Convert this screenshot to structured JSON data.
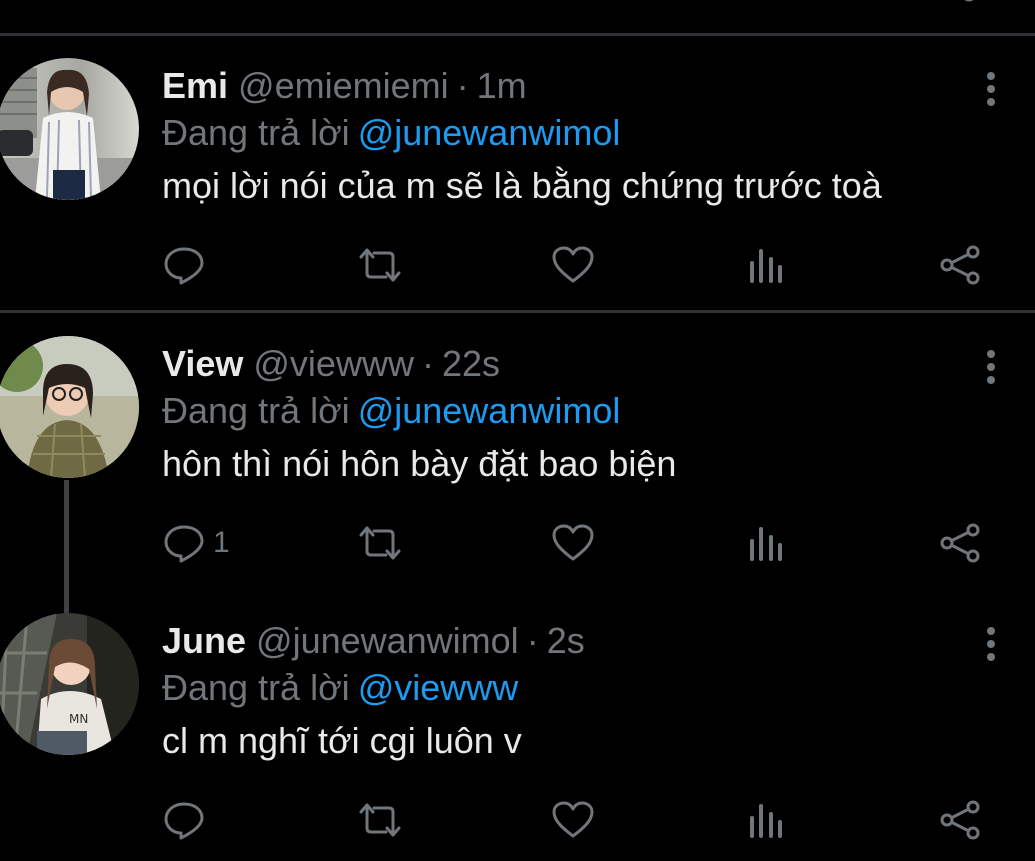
{
  "reply_prefix": "Đang trả lời",
  "colors": {
    "background": "#000000",
    "text": "#e7e9ea",
    "muted": "#71767b",
    "link": "#1d9bf0",
    "divider": "#2f3336"
  },
  "tweets": [
    {
      "name": "Emi",
      "handle": "@emiemiemi",
      "dot": "·",
      "time": "1m",
      "reply_to": "@junewanwimol",
      "text": "mọi lời nói của m sẽ là bằng chứng trước toà",
      "reply_count": "",
      "icons": [
        "reply-icon",
        "retweet-icon",
        "like-icon",
        "analytics-icon",
        "share-icon",
        "more-icon"
      ]
    },
    {
      "name": "View",
      "handle": "@viewww",
      "dot": "·",
      "time": "22s",
      "reply_to": "@junewanwimol",
      "text": "hôn thì nói hôn bày đặt bao biện",
      "reply_count": "1",
      "icons": [
        "reply-icon",
        "retweet-icon",
        "like-icon",
        "analytics-icon",
        "share-icon",
        "more-icon"
      ]
    },
    {
      "name": "June",
      "handle": "@junewanwimol",
      "dot": "·",
      "time": "2s",
      "reply_to": "@viewww",
      "text": "cl m nghĩ tới cgi luôn v",
      "reply_count": "",
      "icons": [
        "reply-icon",
        "retweet-icon",
        "like-icon",
        "analytics-icon",
        "share-icon",
        "more-icon"
      ]
    }
  ]
}
